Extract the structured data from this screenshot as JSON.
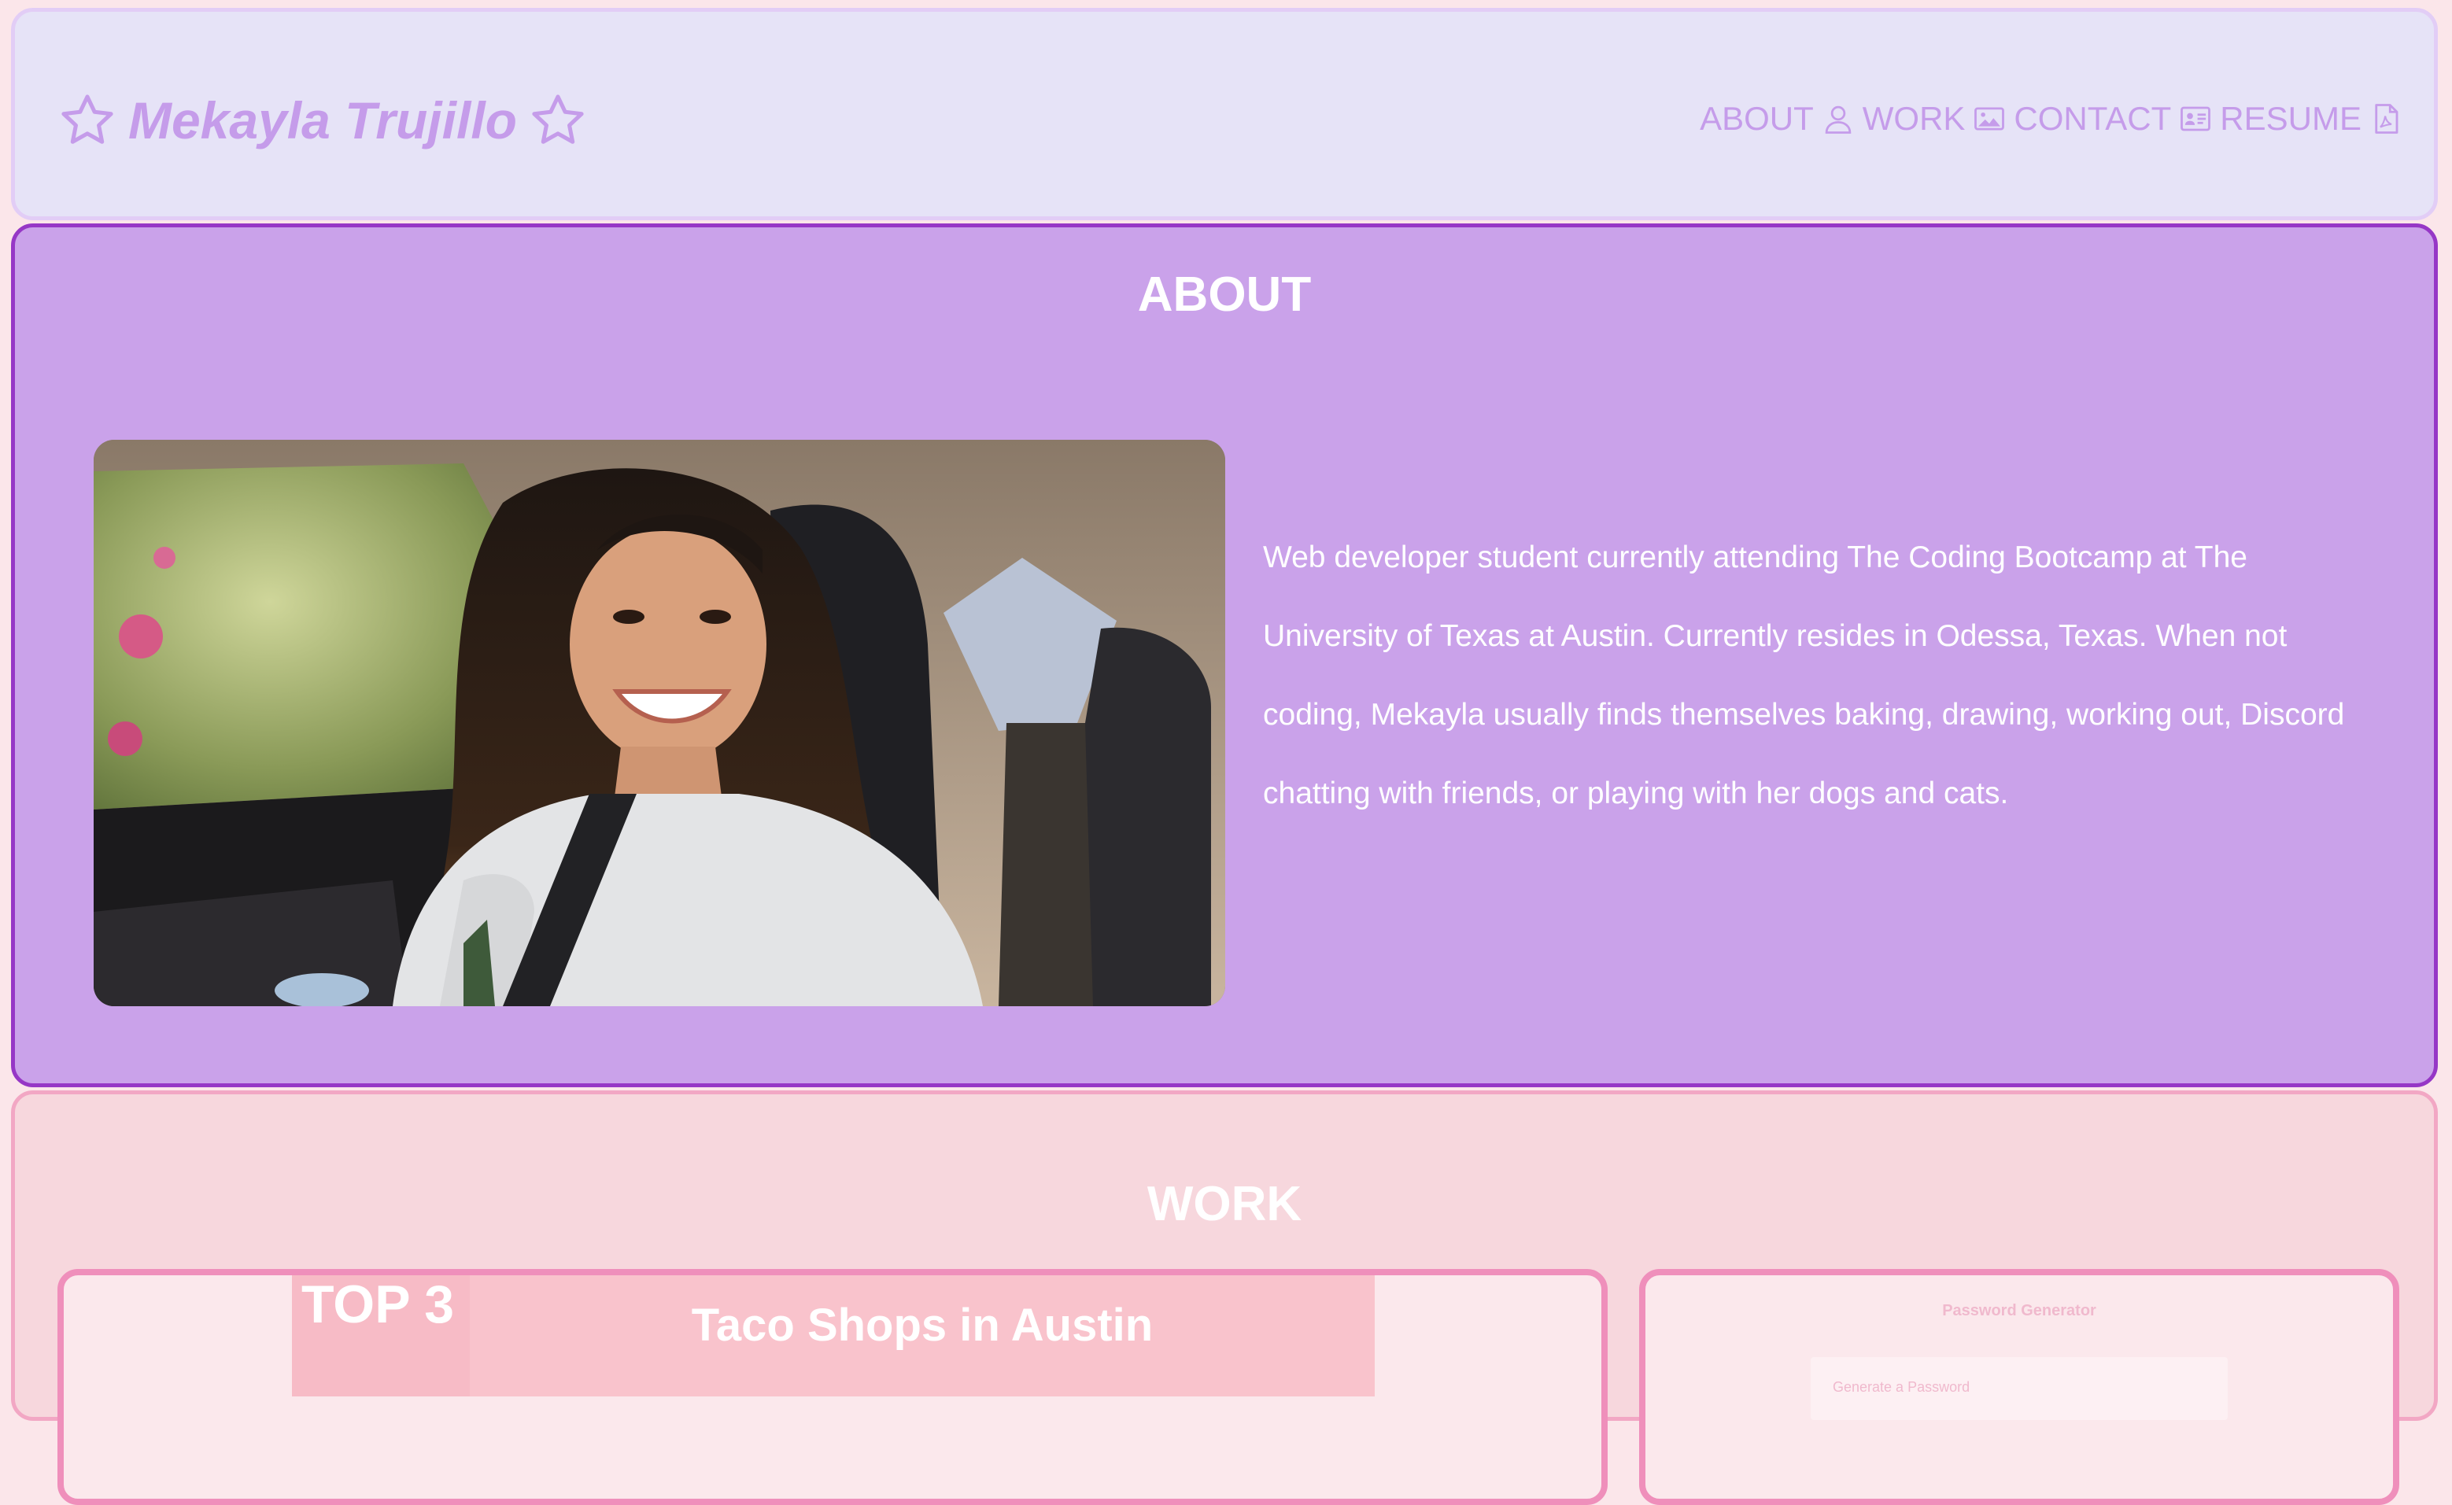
{
  "header": {
    "brand_name": "Mekayla Trujillo",
    "brand_icon_left": "star-outline-icon",
    "brand_icon_right": "star-outline-icon",
    "nav": [
      {
        "label": "ABOUT",
        "icon": "user-icon"
      },
      {
        "label": "WORK",
        "icon": "image-icon"
      },
      {
        "label": "CONTACT",
        "icon": "id-card-icon"
      },
      {
        "label": "RESUME",
        "icon": "pdf-file-icon"
      }
    ]
  },
  "about": {
    "title": "ABOUT",
    "photo_alt": "profile-photo",
    "text": "Web developer student currently attending The Coding Bootcamp at The University of Texas at Austin. Currently resides in Odessa, Texas. When not coding, Mekayla usually finds themselves baking, drawing, working out, Discord chatting with friends, or playing with her dogs and cats."
  },
  "work": {
    "title": "WORK",
    "projects": [
      {
        "top_label": "TOP 3",
        "title": "Taco Shops in Austin"
      },
      {
        "title": "Password Generator",
        "field_placeholder": "Generate a Password"
      }
    ]
  },
  "colors": {
    "header_bg": "#e6e3f7",
    "brand_color": "#c59cea",
    "about_bg": "#caa2ea",
    "about_border": "#9637c6",
    "work_bg": "#f7d7dd",
    "card_border": "#ef8fbb"
  }
}
